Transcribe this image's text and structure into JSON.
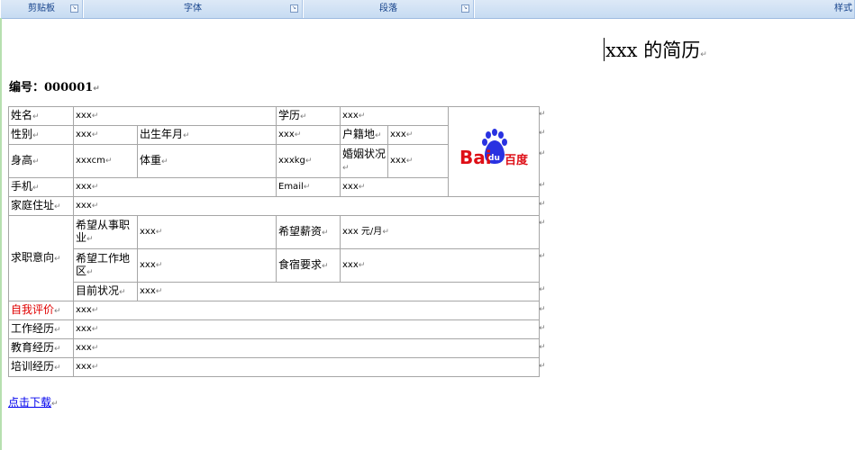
{
  "ribbon": {
    "groups": [
      "剪贴板",
      "字体",
      "段落",
      "样式"
    ]
  },
  "document": {
    "title": "xxx 的简历",
    "serial_label": "编号：",
    "serial_value": "000001",
    "download_link": "点击下载",
    "paragraph_mark": "↵"
  },
  "table": {
    "name_label": "姓名",
    "name_value": "xxx",
    "education_label": "学历",
    "education_value": "xxx",
    "gender_label": "性别",
    "gender_value": "xxx",
    "birth_label": "出生年月",
    "birth_value": "xxx",
    "hukou_label": "户籍地",
    "hukou_value": "xxx",
    "height_label": "身高",
    "height_value": "xxxcm",
    "weight_label": "体重",
    "weight_value": "xxxkg",
    "marital_label": "婚姻状况",
    "marital_value": "xxx",
    "mobile_label": "手机",
    "mobile_value": "xxx",
    "email_label": "Email",
    "email_value": "xxx",
    "address_label": "家庭住址",
    "address_value": "xxx",
    "intent_label": "求职意向",
    "desired_job_label": "希望从事职业",
    "desired_job_value": "xxx",
    "desired_salary_label": "希望薪资",
    "desired_salary_value": "xxx 元/月",
    "desired_location_label": "希望工作地区",
    "desired_location_value": "xxx",
    "accommodation_label": "食宿要求",
    "accommodation_value": "xxx",
    "current_status_label": "目前状况",
    "current_status_value": "xxx",
    "self_eval_label": "自我评价",
    "self_eval_value": "xxx",
    "work_label": "工作经历",
    "work_value": "xxx",
    "edu_history_label": "教育经历",
    "edu_history_value": "xxx",
    "training_label": "培训经历",
    "training_value": "xxx"
  },
  "logo": {
    "text_left": "Bai",
    "text_paw": "du",
    "text_right": "百度"
  },
  "colors": {
    "ribbon_top": "#dde9f7",
    "ribbon_bottom": "#c6dbf2",
    "ribbon_text": "#15428b",
    "border": "#a6a6a6",
    "red_label": "#e00000",
    "link": "#0000ee",
    "baidu_red": "#de0f17",
    "baidu_blue": "#2932e1"
  }
}
